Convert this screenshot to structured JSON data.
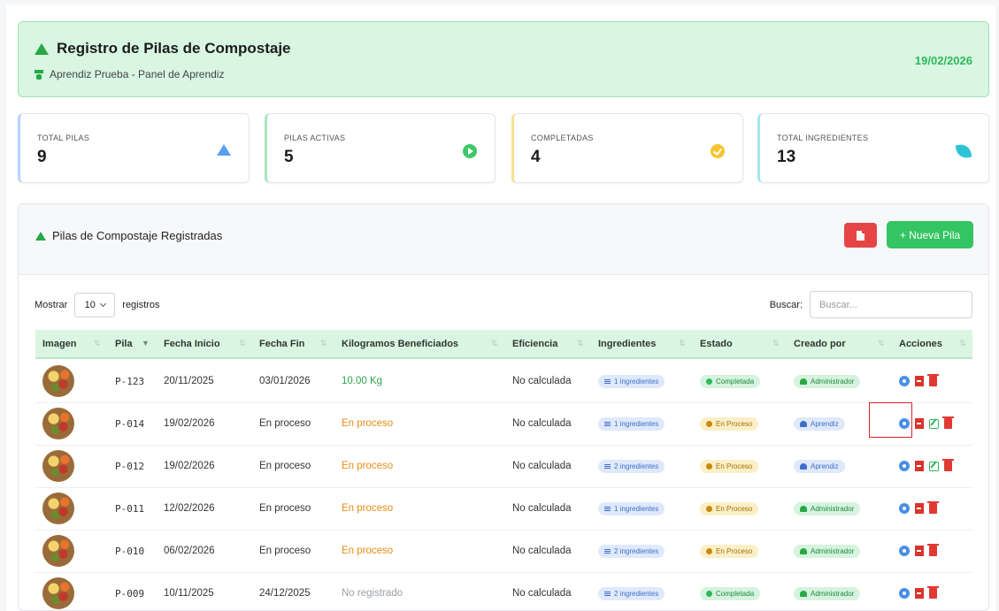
{
  "header": {
    "title": "Registro de Pilas de Compostaje",
    "subtitle": "Aprendiz Prueba - Panel de Aprendiz",
    "date": "19/02/2026"
  },
  "stats": [
    {
      "label": "TOTAL PILAS",
      "value": "9",
      "icon": "triangle-icon",
      "color": "#5b9ef0"
    },
    {
      "label": "PILAS ACTIVAS",
      "value": "5",
      "icon": "play-circle-icon",
      "color": "#3ec86a"
    },
    {
      "label": "COMPLETADAS",
      "value": "4",
      "icon": "check-circle-icon",
      "color": "#f6c531"
    },
    {
      "label": "TOTAL INGREDIENTES",
      "value": "13",
      "icon": "leaf-icon",
      "color": "#2ec4d6"
    }
  ],
  "panel": {
    "title": "Pilas de Compostaje Registradas",
    "new_button": "+ Nueva Pila",
    "show_label": "Mostrar",
    "show_value": "10",
    "records_label": "registros",
    "search_label": "Buscar:",
    "search_placeholder": "Buscar..."
  },
  "columns": [
    "Imagen",
    "Pila",
    "Fecha Inicio",
    "Fecha Fin",
    "Kilogramos Beneficiados",
    "Eficiencia",
    "Ingredientes",
    "Estado",
    "Creado por",
    "Acciones"
  ],
  "rows": [
    {
      "pila": "P-123",
      "inicio": "20/11/2025",
      "fin": "03/01/2026",
      "kg": "10.00 Kg",
      "kg_style": "green",
      "eficiencia": "No calculada",
      "ingredientes": "1 ingredientes",
      "estado": "Completada",
      "estado_type": "done",
      "creado": "Administrador",
      "creado_type": "adm",
      "editable": false
    },
    {
      "pila": "P-014",
      "inicio": "19/02/2026",
      "fin": "En proceso",
      "kg": "En proceso",
      "kg_style": "orange",
      "eficiencia": "No calculada",
      "ingredientes": "1 ingredientes",
      "estado": "En Proceso",
      "estado_type": "prog",
      "creado": "Aprendiz",
      "creado_type": "apr",
      "editable": true
    },
    {
      "pila": "P-012",
      "inicio": "19/02/2026",
      "fin": "En proceso",
      "kg": "En proceso",
      "kg_style": "orange",
      "eficiencia": "No calculada",
      "ingredientes": "2 ingredientes",
      "estado": "En Proceso",
      "estado_type": "prog",
      "creado": "Aprendiz",
      "creado_type": "apr",
      "editable": true
    },
    {
      "pila": "P-011",
      "inicio": "12/02/2026",
      "fin": "En proceso",
      "kg": "En proceso",
      "kg_style": "orange",
      "eficiencia": "No calculada",
      "ingredientes": "1 ingredientes",
      "estado": "En Proceso",
      "estado_type": "prog",
      "creado": "Administrador",
      "creado_type": "adm",
      "editable": false
    },
    {
      "pila": "P-010",
      "inicio": "06/02/2026",
      "fin": "En proceso",
      "kg": "En proceso",
      "kg_style": "orange",
      "eficiencia": "No calculada",
      "ingredientes": "2 ingredientes",
      "estado": "En Proceso",
      "estado_type": "prog",
      "creado": "Administrador",
      "creado_type": "adm",
      "editable": false
    },
    {
      "pila": "P-009",
      "inicio": "10/11/2025",
      "fin": "24/12/2025",
      "kg": "No registrado",
      "kg_style": "grey",
      "eficiencia": "No calculada",
      "ingredientes": "2 ingredientes",
      "estado": "Completada",
      "estado_type": "done",
      "creado": "Administrador",
      "creado_type": "adm",
      "editable": false
    }
  ]
}
